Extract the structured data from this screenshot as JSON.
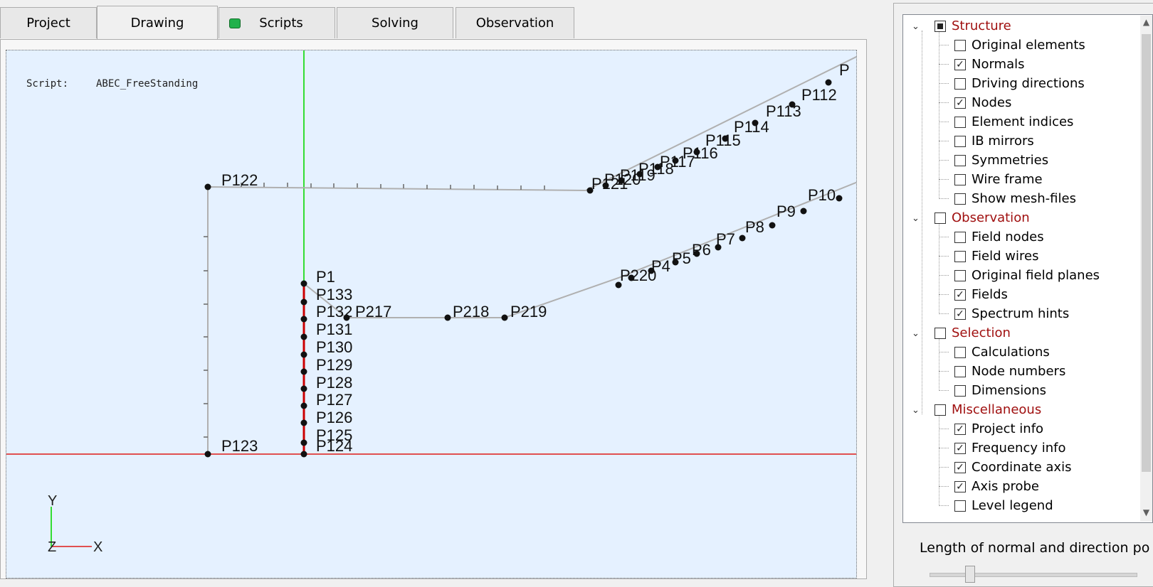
{
  "tabs": [
    {
      "label": "Project"
    },
    {
      "label": "Drawing"
    },
    {
      "label": "Scripts"
    },
    {
      "label": "Solving"
    },
    {
      "label": "Observation"
    }
  ],
  "drawing": {
    "script_label": "Script:",
    "script_name": "ABEC_FreeStanding",
    "axis": {
      "y": "Y",
      "z": "Z",
      "x": "X"
    },
    "point_labels": [
      "P1",
      "P133",
      "P132",
      "P217",
      "P218",
      "P219",
      "P131",
      "P130",
      "P129",
      "P128",
      "P127",
      "P126",
      "P125",
      "P124",
      "P122",
      "P123",
      "P10",
      "P9",
      "P8",
      "P7",
      "P6",
      "P5",
      "P4",
      "P220",
      "P112",
      "P113",
      "P114",
      "P115",
      "P116",
      "P117",
      "P118",
      "P119",
      "P120",
      "P121",
      "P"
    ]
  },
  "tree": {
    "items": [
      {
        "label": "Structure",
        "category": true,
        "state": "partial"
      },
      {
        "label": "Original elements",
        "state": "off"
      },
      {
        "label": "Normals",
        "state": "on"
      },
      {
        "label": "Driving directions",
        "state": "off"
      },
      {
        "label": "Nodes",
        "state": "on"
      },
      {
        "label": "Element indices",
        "state": "off"
      },
      {
        "label": "IB mirrors",
        "state": "off"
      },
      {
        "label": "Symmetries",
        "state": "off"
      },
      {
        "label": "Wire frame",
        "state": "off"
      },
      {
        "label": "Show mesh-files",
        "state": "off"
      },
      {
        "label": "Observation",
        "category": true,
        "state": "off"
      },
      {
        "label": "Field nodes",
        "state": "off"
      },
      {
        "label": "Field wires",
        "state": "off"
      },
      {
        "label": "Original field planes",
        "state": "off"
      },
      {
        "label": "Fields",
        "state": "on"
      },
      {
        "label": "Spectrum hints",
        "state": "on"
      },
      {
        "label": "Selection",
        "category": true,
        "state": "off"
      },
      {
        "label": "Calculations",
        "state": "off"
      },
      {
        "label": "Node numbers",
        "state": "off"
      },
      {
        "label": "Dimensions",
        "state": "off"
      },
      {
        "label": "Miscellaneous",
        "category": true,
        "state": "off"
      },
      {
        "label": "Project info",
        "state": "on"
      },
      {
        "label": "Frequency info",
        "state": "on"
      },
      {
        "label": "Coordinate axis",
        "state": "on"
      },
      {
        "label": "Axis probe",
        "state": "on"
      },
      {
        "label": "Level legend",
        "state": "off"
      }
    ]
  },
  "normals_label": "Length of normal and direction po",
  "colors": {
    "category": "#a01010",
    "axis_x": "#e05050",
    "axis_y": "#33dd33",
    "profile": "#b0b0b0",
    "node": "#111111",
    "red_line": "#cc0000"
  }
}
